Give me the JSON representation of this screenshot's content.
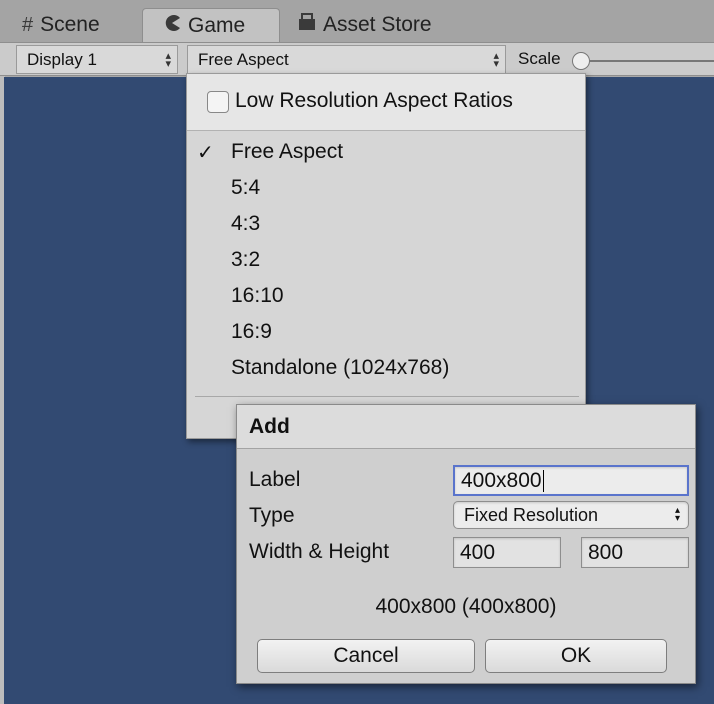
{
  "tabs": [
    {
      "label": "Scene",
      "icon": "grid-icon"
    },
    {
      "label": "Game",
      "icon": "pacman-icon"
    },
    {
      "label": "Asset Store",
      "icon": "store-icon"
    }
  ],
  "toolbar": {
    "display_value": "Display 1",
    "aspect_value": "Free Aspect",
    "scale_label": "Scale"
  },
  "game_view": {
    "background_color": "#324a72"
  },
  "aspect_menu": {
    "low_resolution_label": "Low Resolution Aspect Ratios",
    "low_resolution_checked": false,
    "selected_mark": "✓",
    "items": [
      "Free Aspect",
      "5:4",
      "4:3",
      "3:2",
      "16:10",
      "16:9",
      "Standalone (1024x768)"
    ],
    "selected_index": 0
  },
  "add_dialog": {
    "title": "Add",
    "label_caption": "Label",
    "label_value": "400x800",
    "type_caption": "Type",
    "type_value": "Fixed Resolution",
    "size_caption": "Width & Height",
    "width_value": "400",
    "height_value": "800",
    "summary": "400x800 (400x800)",
    "cancel_label": "Cancel",
    "ok_label": "OK"
  }
}
